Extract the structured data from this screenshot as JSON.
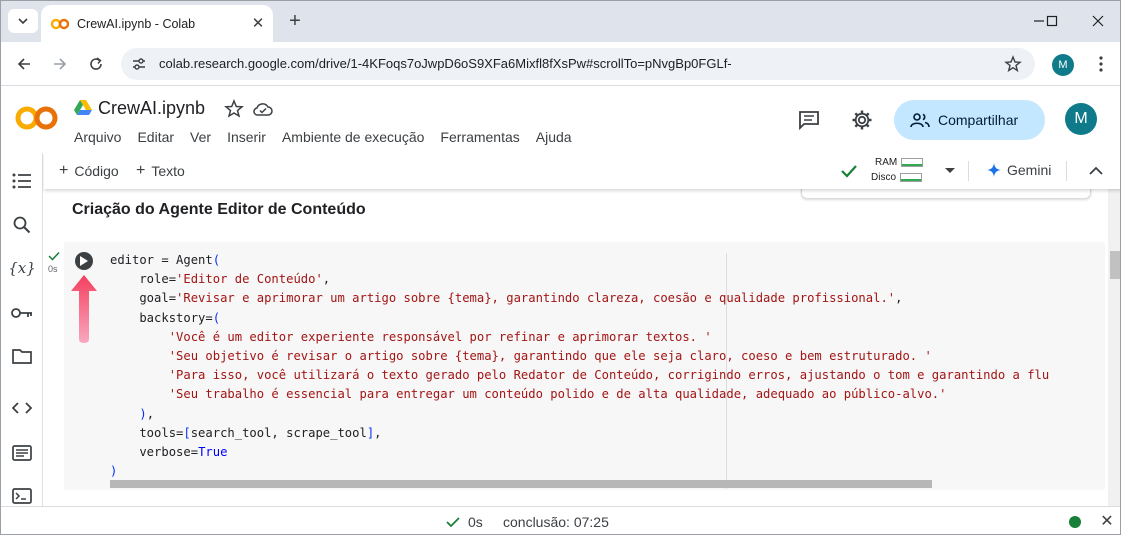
{
  "browser": {
    "tab_title": "CrewAI.ipynb - Colab",
    "url": "colab.research.google.com/drive/1-4KFoqs7oJwpD6oS9XFa6Mixfl8fXsPw#scrollTo=pNvgBp0FGLf-",
    "profile_initial": "M"
  },
  "colab": {
    "notebook_title": "CrewAI.ipynb",
    "menu": [
      "Arquivo",
      "Editar",
      "Ver",
      "Inserir",
      "Ambiente de execução",
      "Ferramentas",
      "Ajuda"
    ],
    "share_label": "Compartilhar",
    "avatar_initial": "M"
  },
  "toolbar": {
    "add_code": "Código",
    "add_text": "Texto",
    "ram_label": "RAM",
    "disk_label": "Disco",
    "gemini_label": "Gemini"
  },
  "notebook": {
    "section_heading": "Criação do Agente Editor de Conteúdo",
    "cell_exec_time": "0s",
    "code_lines": [
      "editor = Agent(",
      "    role='Editor de Conteúdo',",
      "    goal='Revisar e aprimorar um artigo sobre {tema}, garantindo clareza, coesão e qualidade profissional.',",
      "    backstory=(",
      "        'Você é um editor experiente responsável por refinar e aprimorar textos. '",
      "        'Seu objetivo é revisar o artigo sobre {tema}, garantindo que ele seja claro, coeso e bem estruturado. '",
      "        'Para isso, você utilizará o texto gerado pelo Redator de Conteúdo, corrigindo erros, ajustando o tom e garantindo a flu",
      "        'Seu trabalho é essencial para entregar um conteúdo polido e de alta qualidade, adequado ao público-alvo.'",
      "    ),",
      "    tools=[search_tool, scrape_tool],",
      "    verbose=True",
      ")"
    ]
  },
  "status": {
    "time": "0s",
    "completion": "conclusão: 07:25"
  },
  "colors": {
    "accent": "#1a73e8",
    "share_bg": "#c2e7ff",
    "success": "#188038",
    "string": "#a31515",
    "keyword": "#0000ff",
    "arrow": "#f06292"
  }
}
